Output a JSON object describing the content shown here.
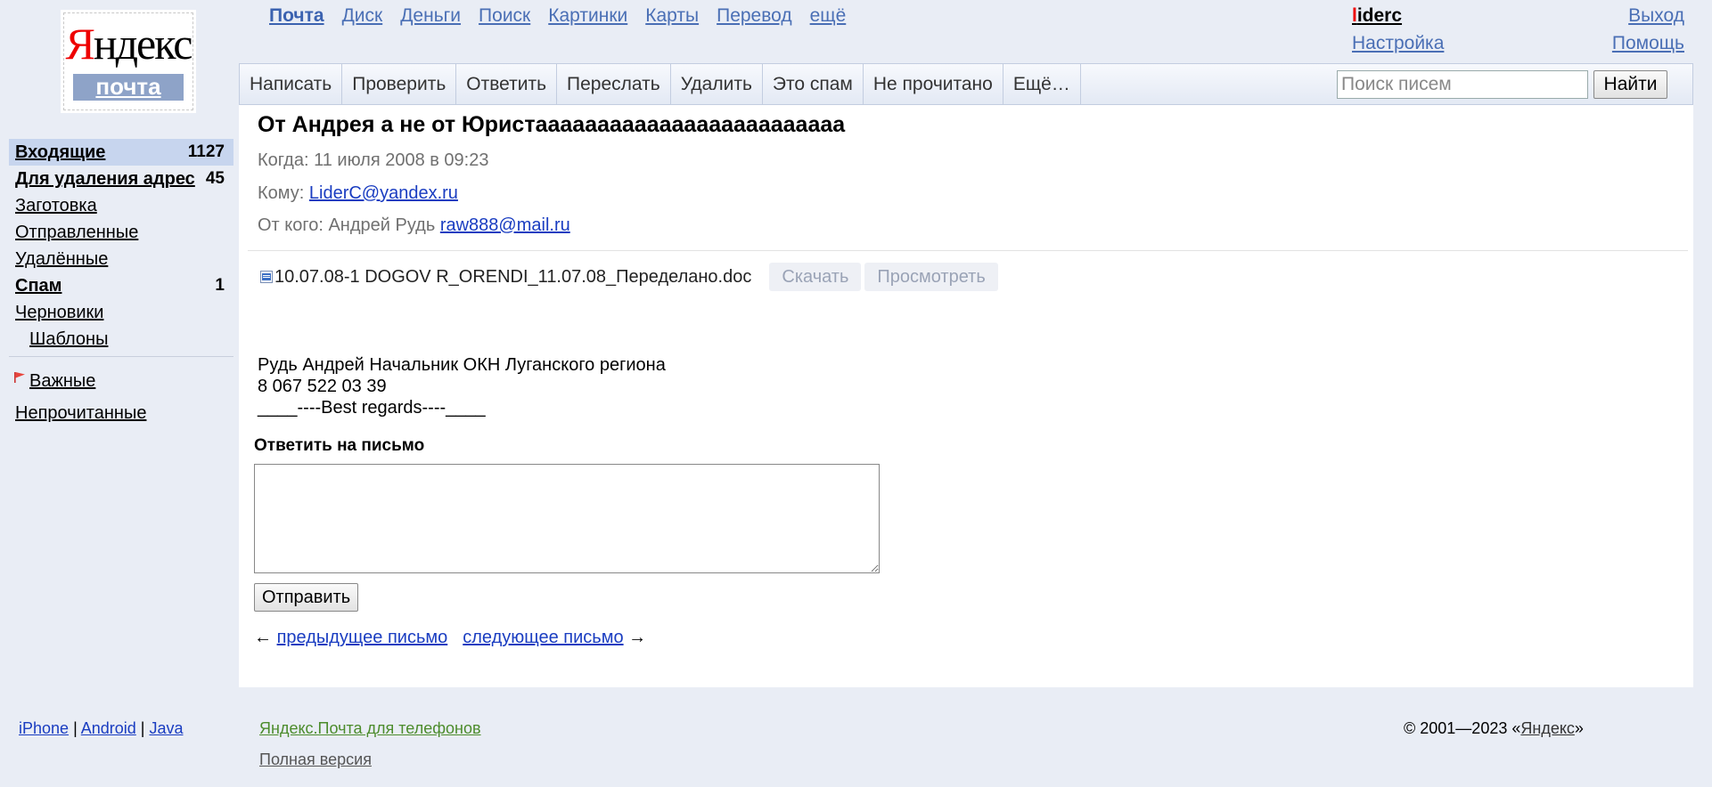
{
  "logo": {
    "brand_first": "Я",
    "brand_rest": "ндекс",
    "product": "почта"
  },
  "services": [
    {
      "label": "Почта",
      "active": true
    },
    {
      "label": "Диск"
    },
    {
      "label": "Деньги"
    },
    {
      "label": "Поиск"
    },
    {
      "label": "Картинки"
    },
    {
      "label": "Карты"
    },
    {
      "label": "Перевод"
    },
    {
      "label": "ещё"
    }
  ],
  "user": {
    "login_first": "l",
    "login_rest": "iderc",
    "settings": "Настройка",
    "logout": "Выход",
    "help": "Помощь"
  },
  "toolbar": {
    "buttons": [
      "Написать",
      "Проверить",
      "Ответить",
      "Переслать",
      "Удалить",
      "Это спам",
      "Не прочитано",
      "Ещё…"
    ],
    "search_placeholder": "Поиск писем",
    "search_button": "Найти"
  },
  "folders": [
    {
      "label": "Входящие",
      "count": "1127"
    },
    {
      "label": "Для удаления адрес",
      "count": "45"
    },
    {
      "label": "Заготовка",
      "count": ""
    },
    {
      "label": "Отправленные",
      "count": ""
    },
    {
      "label": "Удалённые",
      "count": ""
    },
    {
      "label": "Спам",
      "count": "1"
    },
    {
      "label": "Черновики",
      "count": ""
    },
    {
      "label": "Шаблоны",
      "count": ""
    }
  ],
  "labels": {
    "important": "Важные",
    "unread": "Непрочитанные"
  },
  "message": {
    "subject": "От Андрея а не от Юристааааааааааааааааааааааааа",
    "when_label": "Когда:",
    "when_value": "11 июля 2008 в 09:23",
    "to_label": "Кому:",
    "to_email": "LiderC@yandex.ru",
    "from_label": "От кого:",
    "from_name": "Андрей Рудь",
    "from_email": "raw888@mail.ru",
    "attachment": {
      "filename": "10.07.08-1 DOGOV R_ORENDI_11.07.08_Переделано.doc",
      "download": "Скачать",
      "view": "Просмотреть"
    },
    "body_lines": [
      "Рудь Андрей Начальник ОКН Луганского региона",
      "8 067 522 03 39",
      "____----Best regards----____"
    ]
  },
  "reply": {
    "heading": "Ответить на письмо",
    "send": "Отправить"
  },
  "navigation": {
    "prev_arrow": "←",
    "prev": "предыдущее письмо",
    "next": "следующее письмо",
    "next_arrow": "→"
  },
  "footer": {
    "apps": [
      "iPhone",
      "Android",
      "Java"
    ],
    "separator": " | ",
    "mobile": "Яндекс.Почта для телефонов",
    "full_version": "Полная версия",
    "copyright_prefix": "© 2001—2023 «",
    "copyright_link": "Яндекс",
    "copyright_suffix": "»"
  },
  "colors": {
    "page_bg": "#e9edf5",
    "link": "#1a3dc1",
    "service_link": "#4a6fb5",
    "selected_folder": "#c7d5ee",
    "mobile_link": "#4c8c2c",
    "brand_red": "#ee0000"
  }
}
